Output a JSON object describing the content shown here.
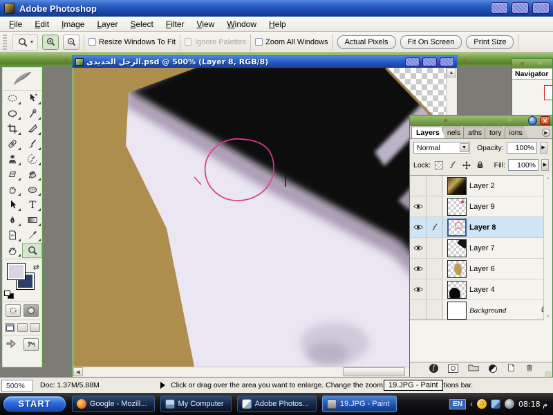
{
  "window": {
    "title": "Adobe Photoshop"
  },
  "menu": {
    "items": [
      "File",
      "Edit",
      "Image",
      "Layer",
      "Select",
      "Filter",
      "View",
      "Window",
      "Help"
    ]
  },
  "options_bar": {
    "checkboxes": [
      {
        "label": "Resize Windows To Fit",
        "checked": false,
        "enabled": true
      },
      {
        "label": "Ignore Palettes",
        "checked": false,
        "enabled": false
      },
      {
        "label": "Zoom All Windows",
        "checked": false,
        "enabled": true
      }
    ],
    "buttons": [
      {
        "label": "Actual Pixels"
      },
      {
        "label": "Fit On Screen"
      },
      {
        "label": "Print Size"
      }
    ]
  },
  "document_window": {
    "title": "الرجل الحديدى.psd @ 500% (Layer 8, RGB/8)"
  },
  "navigator": {
    "tab": "Navigator"
  },
  "layers_panel": {
    "tabs": [
      {
        "label": "Layers"
      },
      {
        "label": "nels"
      },
      {
        "label": "aths"
      },
      {
        "label": "tory"
      },
      {
        "label": "ions"
      }
    ],
    "blend_mode": "Normal",
    "opacity_label": "Opacity:",
    "opacity_value": "100%",
    "lock_label": "Lock:",
    "fill_label": "Fill:",
    "fill_value": "100%",
    "layers": [
      {
        "name": "Layer 2",
        "visible": false,
        "selected": false
      },
      {
        "name": "Layer 9",
        "visible": true,
        "selected": false
      },
      {
        "name": "Layer 8",
        "visible": true,
        "selected": true,
        "painting": true
      },
      {
        "name": "Layer 7",
        "visible": true,
        "selected": false
      },
      {
        "name": "Layer 6",
        "visible": true,
        "selected": false
      },
      {
        "name": "Layer 4",
        "visible": true,
        "selected": false
      },
      {
        "name": "Background",
        "visible": false,
        "selected": false,
        "locked": true
      }
    ]
  },
  "status_bar": {
    "zoom_value": "500%",
    "doc_info": "Doc: 1.37M/5.88M",
    "hint_part1": "Click or drag over the area you want to enlarge. Change the zoom",
    "tooltip": "19.JPG - Paint",
    "hint_part2": "tions bar."
  },
  "taskbar": {
    "start_label": "START",
    "tasks": [
      {
        "label": "Google - Mozill...",
        "active": false
      },
      {
        "label": "My Computer",
        "active": false
      },
      {
        "label": "Adobe Photos...",
        "active": false
      },
      {
        "label": "19.JPG - Paint",
        "active": true
      }
    ],
    "tray": {
      "language": "EN",
      "time": "08:18 م"
    }
  },
  "colors": {
    "titlebar_blue": "#1e52bc",
    "selection_pink": "#e03a8e",
    "canvas_tan": "#ae8e4c",
    "canvas_lavender": "#eae6f2",
    "layer_selected_blue": "#cfe4f7",
    "taskbar_black": "#101010"
  }
}
